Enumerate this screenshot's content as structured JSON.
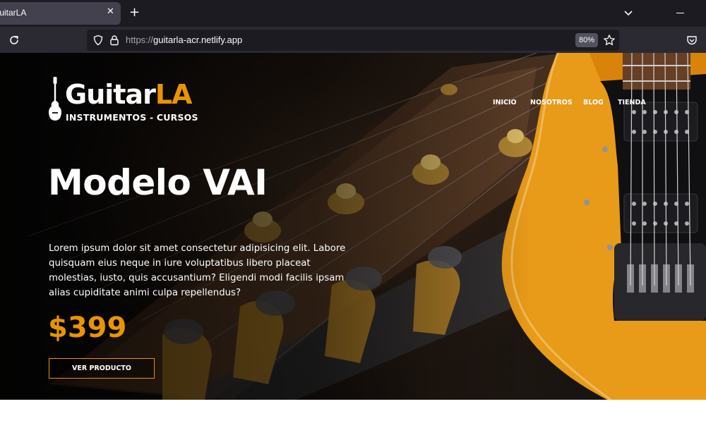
{
  "browser": {
    "tab_title": "GuitarLA",
    "tab_close_glyph": "✕",
    "new_tab_glyph": "+",
    "url_protocol": "https://",
    "url_host": "guitarla-acr.netlify.app",
    "zoom": "80%",
    "icons": [
      "reload-icon",
      "shield-icon",
      "lock-icon",
      "star-icon",
      "pocket-icon",
      "chevron-down-icon",
      "minimize-icon"
    ]
  },
  "site": {
    "logo": {
      "word1": "Guitar",
      "word2": "LA",
      "tagline": "INSTRUMENTOS - CURSOS"
    },
    "nav": [
      {
        "label": "INICIO"
      },
      {
        "label": "NOSOTROS"
      },
      {
        "label": "BLOG"
      },
      {
        "label": "TIENDA"
      }
    ],
    "hero": {
      "title": "Modelo VAI",
      "description": "Lorem ipsum dolor sit amet consectetur adipisicing elit. Labore quisquam eius neque in iure voluptatibus libero placeat molestias, iusto, quis accusantium? Eligendi modi facilis ipsam alias cupiditate animi culpa repellendus?",
      "price": "$399",
      "button_label": "VER PRODUCTO"
    }
  },
  "colors": {
    "accent": "#e99401",
    "guitar_body": "#f4a21a",
    "browser_bg": "#1c1b22",
    "toolbar_bg": "#2b2a33"
  }
}
